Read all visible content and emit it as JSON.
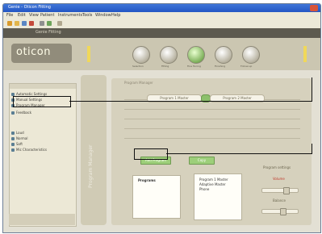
{
  "window": {
    "title": "Genie - Oticon Fitting"
  },
  "menu": [
    "File",
    "Edit",
    "View",
    "Patient",
    "Instruments",
    "Tools",
    "Window",
    "Help"
  ],
  "brand": {
    "logo": "oticon",
    "tabs": "Genie  Fitting"
  },
  "steps": [
    {
      "label": "Selection"
    },
    {
      "label": "Fitting"
    },
    {
      "label": "Fine Tuning"
    },
    {
      "label": "Finishing"
    },
    {
      "label": "Follow-up"
    }
  ],
  "left": {
    "items": [
      "Automatic Settings",
      "Manual Settings",
      "Program Manager",
      "Feedback",
      "Loud",
      "Normal",
      "Soft",
      "Mic Characteristics"
    ]
  },
  "main": {
    "title": "Program Manager",
    "pill_left": "Program 1 Master",
    "pill_right": "Program 2 Master",
    "btn1": "Add Program",
    "btn2": "Copy",
    "box1_title": "Programs",
    "box2_lines": [
      "Program 1 Master",
      "Adaptive Master",
      "Phone"
    ],
    "right_title": "Program settings",
    "slider1": "Volume",
    "slider2": "Balance",
    "slider1_value": 0.6,
    "slider2_value": 0.5
  },
  "colors": {
    "active": "#8cc06b",
    "callout": "#111111"
  }
}
